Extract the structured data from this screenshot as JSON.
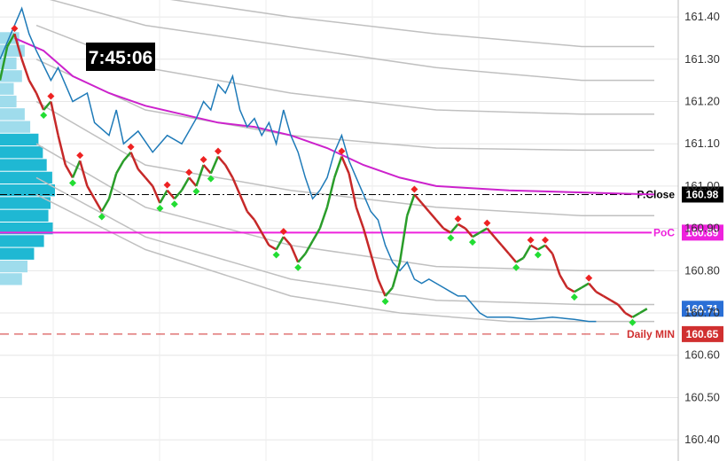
{
  "clock": {
    "time": "7:45:06"
  },
  "chart_data": {
    "type": "line",
    "ylim": [
      160.35,
      161.44
    ],
    "y_ticks": [
      "161.40",
      "161.30",
      "161.20",
      "161.10",
      "161.00",
      "160.90",
      "160.80",
      "160.70",
      "160.60",
      "160.50",
      "160.40"
    ],
    "grid": true,
    "levels": [
      {
        "label": "P.Close",
        "value": "160.98",
        "y": 160.98,
        "style": "dash-dot",
        "color": "#000000"
      },
      {
        "label": "PoC",
        "value": "160.89",
        "y": 160.89,
        "style": "solid",
        "color": "#ee22dd"
      },
      {
        "label": "",
        "value": "160.71",
        "y": 160.71,
        "style": "badge",
        "color": "#2a6fd6"
      },
      {
        "label": "Daily MIN",
        "value": "160.65",
        "y": 160.65,
        "style": "dashed",
        "color": "#d03030"
      }
    ],
    "price": [
      [
        0,
        161.25
      ],
      [
        0.01,
        161.33
      ],
      [
        0.02,
        161.36
      ],
      [
        0.03,
        161.3
      ],
      [
        0.04,
        161.25
      ],
      [
        0.05,
        161.22
      ],
      [
        0.06,
        161.18
      ],
      [
        0.07,
        161.2
      ],
      [
        0.08,
        161.12
      ],
      [
        0.09,
        161.05
      ],
      [
        0.1,
        161.02
      ],
      [
        0.11,
        161.06
      ],
      [
        0.12,
        161.0
      ],
      [
        0.13,
        160.97
      ],
      [
        0.14,
        160.94
      ],
      [
        0.15,
        160.97
      ],
      [
        0.16,
        161.03
      ],
      [
        0.17,
        161.06
      ],
      [
        0.18,
        161.08
      ],
      [
        0.19,
        161.04
      ],
      [
        0.2,
        161.02
      ],
      [
        0.21,
        161.0
      ],
      [
        0.22,
        160.96
      ],
      [
        0.23,
        160.99
      ],
      [
        0.24,
        160.97
      ],
      [
        0.25,
        160.99
      ],
      [
        0.26,
        161.02
      ],
      [
        0.27,
        161.0
      ],
      [
        0.28,
        161.05
      ],
      [
        0.29,
        161.03
      ],
      [
        0.3,
        161.07
      ],
      [
        0.31,
        161.05
      ],
      [
        0.32,
        161.02
      ],
      [
        0.33,
        160.98
      ],
      [
        0.34,
        160.94
      ],
      [
        0.35,
        160.92
      ],
      [
        0.36,
        160.89
      ],
      [
        0.37,
        160.86
      ],
      [
        0.38,
        160.85
      ],
      [
        0.39,
        160.88
      ],
      [
        0.4,
        160.86
      ],
      [
        0.41,
        160.82
      ],
      [
        0.42,
        160.84
      ],
      [
        0.43,
        160.87
      ],
      [
        0.44,
        160.9
      ],
      [
        0.45,
        160.95
      ],
      [
        0.46,
        161.02
      ],
      [
        0.47,
        161.07
      ],
      [
        0.48,
        161.03
      ],
      [
        0.49,
        160.95
      ],
      [
        0.5,
        160.9
      ],
      [
        0.51,
        160.84
      ],
      [
        0.52,
        160.78
      ],
      [
        0.53,
        160.74
      ],
      [
        0.54,
        160.76
      ],
      [
        0.55,
        160.82
      ],
      [
        0.56,
        160.93
      ],
      [
        0.57,
        160.98
      ],
      [
        0.58,
        160.96
      ],
      [
        0.59,
        160.94
      ],
      [
        0.6,
        160.92
      ],
      [
        0.61,
        160.9
      ],
      [
        0.62,
        160.89
      ],
      [
        0.63,
        160.91
      ],
      [
        0.64,
        160.9
      ],
      [
        0.65,
        160.88
      ],
      [
        0.66,
        160.89
      ],
      [
        0.67,
        160.9
      ],
      [
        0.68,
        160.88
      ],
      [
        0.69,
        160.86
      ],
      [
        0.7,
        160.84
      ],
      [
        0.71,
        160.82
      ],
      [
        0.72,
        160.83
      ],
      [
        0.73,
        160.86
      ],
      [
        0.74,
        160.85
      ],
      [
        0.75,
        160.86
      ],
      [
        0.76,
        160.84
      ],
      [
        0.77,
        160.79
      ],
      [
        0.78,
        160.76
      ],
      [
        0.79,
        160.75
      ],
      [
        0.8,
        160.76
      ],
      [
        0.81,
        160.77
      ],
      [
        0.82,
        160.75
      ],
      [
        0.83,
        160.74
      ],
      [
        0.84,
        160.73
      ],
      [
        0.85,
        160.72
      ],
      [
        0.86,
        160.7
      ],
      [
        0.87,
        160.69
      ],
      [
        0.88,
        160.7
      ],
      [
        0.89,
        160.71
      ]
    ],
    "vwap": [
      [
        0.02,
        161.35
      ],
      [
        0.06,
        161.32
      ],
      [
        0.1,
        161.26
      ],
      [
        0.15,
        161.22
      ],
      [
        0.2,
        161.19
      ],
      [
        0.25,
        161.17
      ],
      [
        0.3,
        161.15
      ],
      [
        0.35,
        161.14
      ],
      [
        0.4,
        161.12
      ],
      [
        0.45,
        161.09
      ],
      [
        0.5,
        161.05
      ],
      [
        0.55,
        161.02
      ],
      [
        0.6,
        161.0
      ],
      [
        0.7,
        160.99
      ],
      [
        0.8,
        160.985
      ],
      [
        0.9,
        160.98
      ]
    ],
    "fast_line": [
      [
        0,
        161.3
      ],
      [
        0.02,
        161.38
      ],
      [
        0.03,
        161.42
      ],
      [
        0.04,
        161.36
      ],
      [
        0.05,
        161.32
      ],
      [
        0.07,
        161.25
      ],
      [
        0.08,
        161.28
      ],
      [
        0.1,
        161.2
      ],
      [
        0.12,
        161.22
      ],
      [
        0.13,
        161.15
      ],
      [
        0.15,
        161.12
      ],
      [
        0.16,
        161.18
      ],
      [
        0.17,
        161.1
      ],
      [
        0.19,
        161.13
      ],
      [
        0.21,
        161.08
      ],
      [
        0.23,
        161.12
      ],
      [
        0.25,
        161.1
      ],
      [
        0.27,
        161.16
      ],
      [
        0.28,
        161.2
      ],
      [
        0.29,
        161.18
      ],
      [
        0.3,
        161.24
      ],
      [
        0.31,
        161.22
      ],
      [
        0.32,
        161.26
      ],
      [
        0.33,
        161.18
      ],
      [
        0.34,
        161.14
      ],
      [
        0.35,
        161.16
      ],
      [
        0.36,
        161.12
      ],
      [
        0.37,
        161.15
      ],
      [
        0.38,
        161.1
      ],
      [
        0.39,
        161.18
      ],
      [
        0.4,
        161.12
      ],
      [
        0.41,
        161.08
      ],
      [
        0.42,
        161.02
      ],
      [
        0.43,
        160.97
      ],
      [
        0.44,
        160.99
      ],
      [
        0.45,
        161.02
      ],
      [
        0.46,
        161.08
      ],
      [
        0.47,
        161.12
      ],
      [
        0.48,
        161.06
      ],
      [
        0.49,
        161.02
      ],
      [
        0.5,
        160.98
      ],
      [
        0.51,
        160.94
      ],
      [
        0.52,
        160.92
      ],
      [
        0.53,
        160.86
      ],
      [
        0.54,
        160.82
      ],
      [
        0.55,
        160.8
      ],
      [
        0.56,
        160.82
      ],
      [
        0.57,
        160.78
      ],
      [
        0.58,
        160.77
      ],
      [
        0.59,
        160.78
      ],
      [
        0.6,
        160.77
      ],
      [
        0.61,
        160.76
      ],
      [
        0.62,
        160.75
      ],
      [
        0.63,
        160.74
      ],
      [
        0.64,
        160.74
      ],
      [
        0.65,
        160.72
      ],
      [
        0.66,
        160.7
      ],
      [
        0.67,
        160.69
      ],
      [
        0.68,
        160.69
      ],
      [
        0.7,
        160.69
      ],
      [
        0.73,
        160.685
      ],
      [
        0.76,
        160.69
      ],
      [
        0.79,
        160.685
      ],
      [
        0.81,
        160.68
      ],
      [
        0.82,
        160.68
      ]
    ],
    "bands": [
      [
        [
          0.05,
          161.5
        ],
        [
          0.2,
          161.45
        ],
        [
          0.4,
          161.4
        ],
        [
          0.6,
          161.36
        ],
        [
          0.8,
          161.33
        ],
        [
          0.9,
          161.33
        ]
      ],
      [
        [
          0.05,
          161.45
        ],
        [
          0.2,
          161.38
        ],
        [
          0.4,
          161.33
        ],
        [
          0.6,
          161.28
        ],
        [
          0.8,
          161.25
        ],
        [
          0.9,
          161.25
        ]
      ],
      [
        [
          0.05,
          161.38
        ],
        [
          0.2,
          161.28
        ],
        [
          0.4,
          161.22
        ],
        [
          0.6,
          161.18
        ],
        [
          0.8,
          161.17
        ],
        [
          0.9,
          161.17
        ]
      ],
      [
        [
          0.05,
          161.3
        ],
        [
          0.2,
          161.18
        ],
        [
          0.4,
          161.12
        ],
        [
          0.6,
          161.09
        ],
        [
          0.8,
          161.085
        ],
        [
          0.9,
          161.085
        ]
      ],
      [
        [
          0.05,
          161.2
        ],
        [
          0.2,
          161.05
        ],
        [
          0.4,
          160.99
        ],
        [
          0.6,
          160.95
        ],
        [
          0.8,
          160.93
        ],
        [
          0.9,
          160.93
        ]
      ],
      [
        [
          0.05,
          161.1
        ],
        [
          0.2,
          160.95
        ],
        [
          0.4,
          160.86
        ],
        [
          0.6,
          160.81
        ],
        [
          0.8,
          160.8
        ],
        [
          0.9,
          160.8
        ]
      ],
      [
        [
          0.05,
          161.02
        ],
        [
          0.2,
          160.88
        ],
        [
          0.4,
          160.78
        ],
        [
          0.6,
          160.73
        ],
        [
          0.8,
          160.72
        ],
        [
          0.9,
          160.72
        ]
      ],
      [
        [
          0.05,
          160.98
        ],
        [
          0.2,
          160.85
        ],
        [
          0.4,
          160.74
        ],
        [
          0.55,
          160.7
        ],
        [
          0.7,
          160.68
        ],
        [
          0.9,
          160.68
        ]
      ]
    ],
    "volume_profile": [
      [
        161.35,
        0.35
      ],
      [
        161.32,
        0.45
      ],
      [
        161.29,
        0.3
      ],
      [
        161.26,
        0.4
      ],
      [
        161.23,
        0.25
      ],
      [
        161.2,
        0.3
      ],
      [
        161.17,
        0.45
      ],
      [
        161.14,
        0.55
      ],
      [
        161.11,
        0.7
      ],
      [
        161.08,
        0.78
      ],
      [
        161.05,
        0.85
      ],
      [
        161.02,
        0.95
      ],
      [
        160.99,
        1.0
      ],
      [
        160.96,
        0.92
      ],
      [
        160.93,
        0.88
      ],
      [
        160.9,
        0.96
      ],
      [
        160.87,
        0.8
      ],
      [
        160.84,
        0.62
      ],
      [
        160.81,
        0.5
      ],
      [
        160.78,
        0.4
      ]
    ]
  }
}
